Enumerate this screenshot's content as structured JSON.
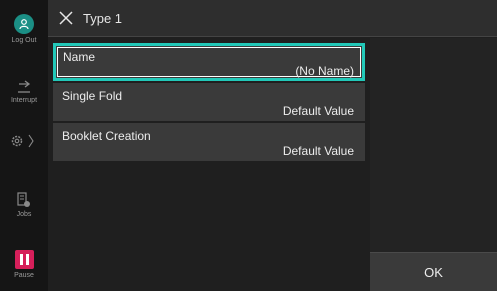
{
  "rail": {
    "logout_label": "Log Out",
    "interrupt_label": "Interrupt",
    "jobs_label": "Jobs",
    "pause_label": "Pause"
  },
  "header": {
    "title": "Type 1"
  },
  "list": {
    "items": [
      {
        "label": "Name",
        "value": "(No Name)"
      },
      {
        "label": "Single Fold",
        "value": "Default Value"
      },
      {
        "label": "Booklet Creation",
        "value": "Default Value"
      }
    ]
  },
  "actions": {
    "ok_label": "OK"
  },
  "colors": {
    "accent": "#22c8b8",
    "avatar": "#1b8f85",
    "pause": "#d61f5a"
  }
}
